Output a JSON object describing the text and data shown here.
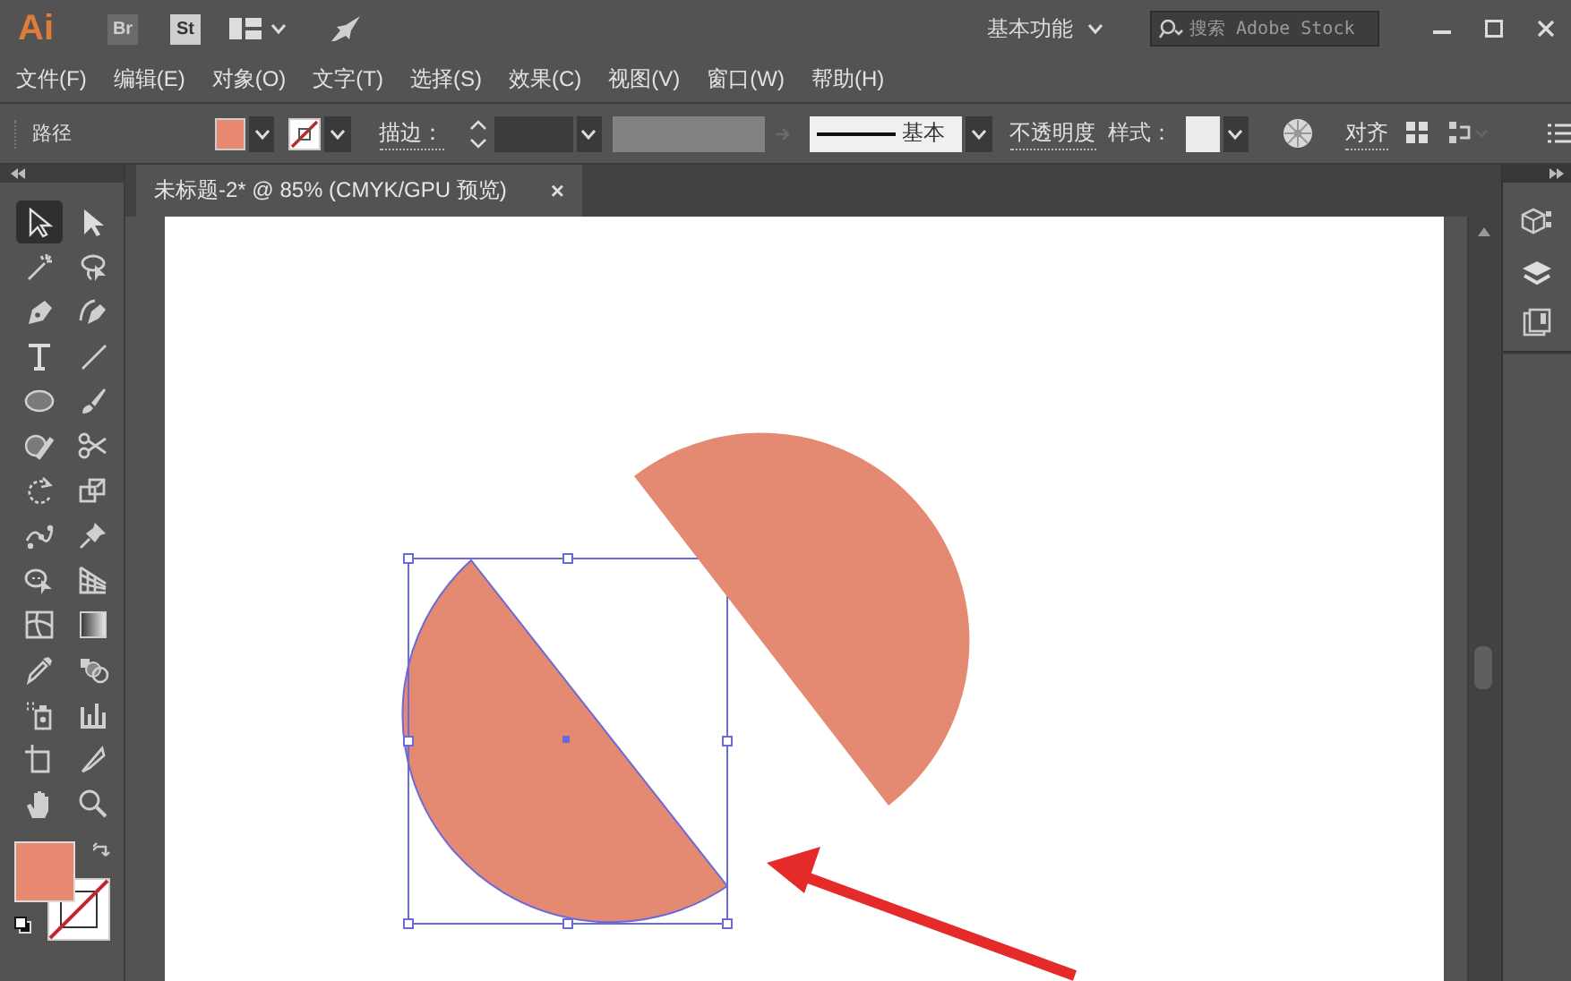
{
  "title_bar": {
    "app_logo": "Ai",
    "bridge_button": "Br",
    "stock_button": "St",
    "workspace": "基本功能",
    "search": {
      "placeholder": "搜索 Adobe Stock"
    }
  },
  "menu_bar": [
    "文件(F)",
    "编辑(E)",
    "对象(O)",
    "文字(T)",
    "选择(S)",
    "效果(C)",
    "视图(V)",
    "窗口(W)",
    "帮助(H)"
  ],
  "control_bar": {
    "object_type": "路径",
    "stroke_label": "描边：",
    "stroke_profile": "基本",
    "opacity_label": "不透明度",
    "style_label": "样式：",
    "align_label": "对齐"
  },
  "document_tab": {
    "title": "未标题-2* @ 85% (CMYK/GPU 预览)",
    "close": "×"
  },
  "tools": [
    {
      "kind": "selection",
      "selected": true
    },
    {
      "kind": "direct-selection",
      "selected": false
    },
    {
      "kind": "magic-wand",
      "selected": false
    },
    {
      "kind": "lasso",
      "selected": false
    },
    {
      "kind": "pen",
      "selected": false
    },
    {
      "kind": "curvature",
      "selected": false
    },
    {
      "kind": "type",
      "selected": false
    },
    {
      "kind": "line",
      "selected": false
    },
    {
      "kind": "ellipse",
      "selected": false
    },
    {
      "kind": "paintbrush",
      "selected": false
    },
    {
      "kind": "shaper",
      "selected": false
    },
    {
      "kind": "scissors",
      "selected": false
    },
    {
      "kind": "rotate",
      "selected": false
    },
    {
      "kind": "scale",
      "selected": false
    },
    {
      "kind": "puppet-warp",
      "selected": false
    },
    {
      "kind": "pin",
      "selected": false
    },
    {
      "kind": "shape-builder",
      "selected": false
    },
    {
      "kind": "perspective-grid",
      "selected": false
    },
    {
      "kind": "mesh",
      "selected": false
    },
    {
      "kind": "gradient",
      "selected": false
    },
    {
      "kind": "eyedropper",
      "selected": false
    },
    {
      "kind": "blend",
      "selected": false
    },
    {
      "kind": "symbol-sprayer",
      "selected": false
    },
    {
      "kind": "graph",
      "selected": false
    },
    {
      "kind": "artboard",
      "selected": false
    },
    {
      "kind": "slice",
      "selected": false
    },
    {
      "kind": "hand",
      "selected": false
    },
    {
      "kind": "zoom",
      "selected": false
    }
  ],
  "canvas_objects": [
    {
      "kind": "half-disc-left",
      "selected": true
    },
    {
      "kind": "half-disc-right",
      "selected": false
    }
  ]
}
